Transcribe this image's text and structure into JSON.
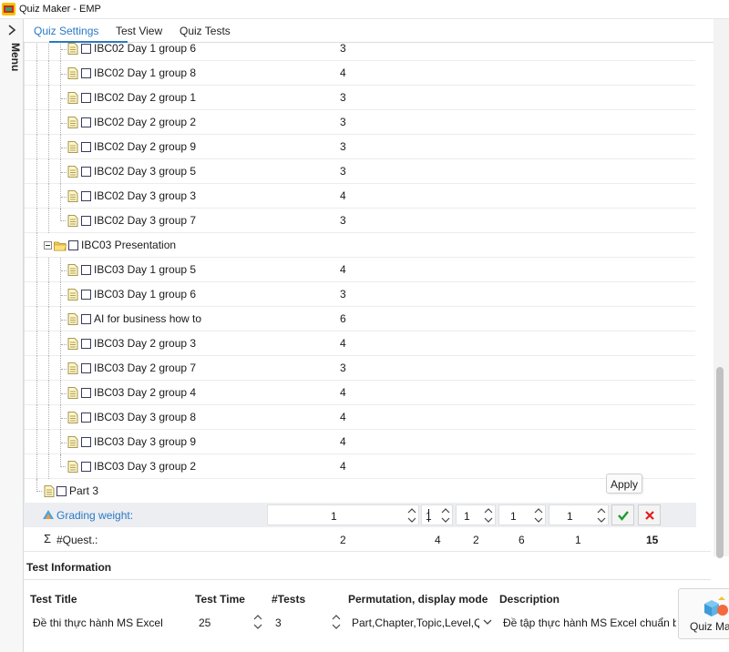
{
  "window": {
    "title": "Quiz Maker - EMP"
  },
  "menu": {
    "label": "Menu"
  },
  "tabs": [
    {
      "label": "Quiz Settings"
    },
    {
      "label": "Test View"
    },
    {
      "label": "Quiz Tests"
    }
  ],
  "tree": {
    "rows": [
      {
        "label": "IBC02 Day 1 group 6",
        "count": "3"
      },
      {
        "label": "IBC02 Day 1 group 8",
        "count": "4"
      },
      {
        "label": "IBC02 Day 2 group 1",
        "count": "3"
      },
      {
        "label": "IBC02 Day 2 group 2",
        "count": "3"
      },
      {
        "label": "IBC02 Day 2 group 9",
        "count": "3"
      },
      {
        "label": "IBC02 Day 3 group 5",
        "count": "3"
      },
      {
        "label": "IBC02 Day 3 group 3",
        "count": "4"
      },
      {
        "label": "IBC02 Day 3 group 7",
        "count": "3"
      },
      {
        "label": "IBC03 Presentation",
        "count": ""
      },
      {
        "label": "IBC03 Day 1 group 5",
        "count": "4"
      },
      {
        "label": "IBC03 Day 1 group 6",
        "count": "3"
      },
      {
        "label": "AI for business how to",
        "count": "6"
      },
      {
        "label": "IBC03 Day 2 group 3",
        "count": "4"
      },
      {
        "label": "IBC03 Day 2 group 7",
        "count": "3"
      },
      {
        "label": "IBC03 Day 2 group 4",
        "count": "4"
      },
      {
        "label": "IBC03 Day 3 group 8",
        "count": "4"
      },
      {
        "label": "IBC03 Day 3 group 9",
        "count": "4"
      },
      {
        "label": "IBC03 Day 3 group 2",
        "count": "4"
      },
      {
        "label": "Part 3",
        "count": ""
      }
    ]
  },
  "grading": {
    "label": "Grading weight:",
    "values": [
      "1",
      "1",
      "1",
      "1",
      "1"
    ],
    "apply_tooltip": "Apply"
  },
  "quest": {
    "label": "#Quest.:",
    "values": [
      "2",
      "4",
      "2",
      "6",
      "1"
    ],
    "total": "15"
  },
  "test_info": {
    "title": "Test Information",
    "headers": {
      "title": "Test Title",
      "time": "Test Time",
      "tests": "#Tests",
      "perm": "Permutation, display mode",
      "desc": "Description"
    },
    "values": {
      "title": "Đề thi thực hành MS Excel",
      "time": "25",
      "tests": "3",
      "perm": "Part,Chapter,Topic,Level,Q",
      "desc": "Đề tập thực hành MS Excel chuẩn b"
    }
  },
  "quiz_button": {
    "label": "Quiz Ma"
  },
  "colors": {
    "accent": "#2a78c4",
    "apply": "#1e9a2c",
    "cancel": "#e02020"
  }
}
